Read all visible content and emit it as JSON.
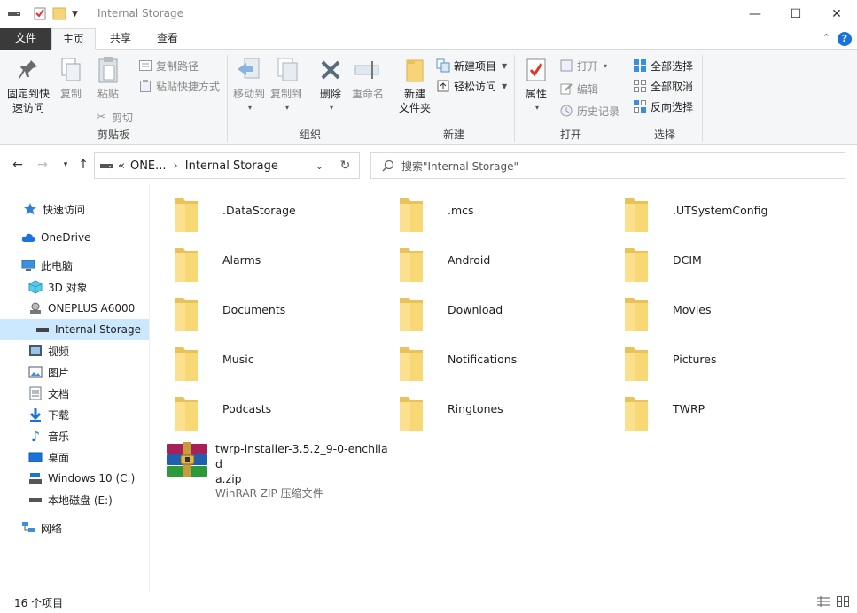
{
  "window": {
    "title": "Internal Storage",
    "controls": {
      "minimize": "—",
      "maximize": "☐",
      "close": "✕"
    }
  },
  "ribbon_tabs": [
    {
      "label": "文件"
    },
    {
      "label": "主页"
    },
    {
      "label": "共享"
    },
    {
      "label": "查看"
    }
  ],
  "help_label": "?",
  "ribbon": {
    "clipboard": {
      "label": "剪贴板",
      "pin": "固定到快速访问",
      "pin_line1": "固定到快",
      "pin_line2": "速访问",
      "copy": "复制",
      "paste": "粘贴",
      "copy_path": "复制路径",
      "paste_shortcut": "粘贴快捷方式",
      "cut": "剪切"
    },
    "organize": {
      "label": "组织",
      "move_to": "移动到",
      "copy_to": "复制到",
      "delete": "删除",
      "rename": "重命名"
    },
    "new": {
      "label": "新建",
      "new_folder_line1": "新建",
      "new_folder_line2": "文件夹",
      "new_item": "新建项目",
      "easy_access": "轻松访问"
    },
    "open": {
      "label": "打开",
      "properties": "属性",
      "open": "打开",
      "edit": "编辑",
      "history": "历史记录"
    },
    "select": {
      "label": "选择",
      "select_all": "全部选择",
      "select_none": "全部取消",
      "invert": "反向选择"
    }
  },
  "address": {
    "prefix": "«",
    "crumb_parent": "ONE...",
    "crumb_current": "Internal Storage",
    "search_placeholder": "搜索\"Internal Storage\""
  },
  "sidebar": {
    "items": [
      {
        "label": "快速访问",
        "icon": "star-icon"
      },
      {
        "label": "OneDrive",
        "icon": "cloud-icon"
      },
      {
        "label": "此电脑",
        "icon": "pc-icon"
      },
      {
        "label": "3D 对象",
        "icon": "cube-icon"
      },
      {
        "label": "ONEPLUS A6000",
        "icon": "phone-icon"
      },
      {
        "label": "Internal Storage",
        "icon": "drive-icon"
      },
      {
        "label": "视频",
        "icon": "video-icon"
      },
      {
        "label": "图片",
        "icon": "pictures-icon"
      },
      {
        "label": "文档",
        "icon": "document-icon"
      },
      {
        "label": "下载",
        "icon": "download-icon"
      },
      {
        "label": "音乐",
        "icon": "music-icon"
      },
      {
        "label": "桌面",
        "icon": "desktop-icon"
      },
      {
        "label": "Windows 10 (C:)",
        "icon": "os-drive-icon"
      },
      {
        "label": "本地磁盘 (E:)",
        "icon": "drive-icon"
      },
      {
        "label": "网络",
        "icon": "network-icon"
      }
    ]
  },
  "folders": [
    {
      "name": ".DataStorage"
    },
    {
      "name": ".mcs"
    },
    {
      "name": ".UTSystemConfig"
    },
    {
      "name": "Alarms"
    },
    {
      "name": "Android"
    },
    {
      "name": "DCIM"
    },
    {
      "name": "Documents"
    },
    {
      "name": "Download"
    },
    {
      "name": "Movies"
    },
    {
      "name": "Music"
    },
    {
      "name": "Notifications"
    },
    {
      "name": "Pictures"
    },
    {
      "name": "Podcasts"
    },
    {
      "name": "Ringtones"
    },
    {
      "name": "TWRP"
    }
  ],
  "zip_file": {
    "name_line1": "twrp-installer-3.5.2_9-0-enchilad",
    "name_line2": "a.zip",
    "type": "WinRAR ZIP 压缩文件"
  },
  "status": {
    "item_count": "16 个项目"
  },
  "colors": {
    "accent": "#1a73d8",
    "folder": "#f6d477",
    "selection": "#cce8ff",
    "file_tab": "#3a3a3a"
  }
}
